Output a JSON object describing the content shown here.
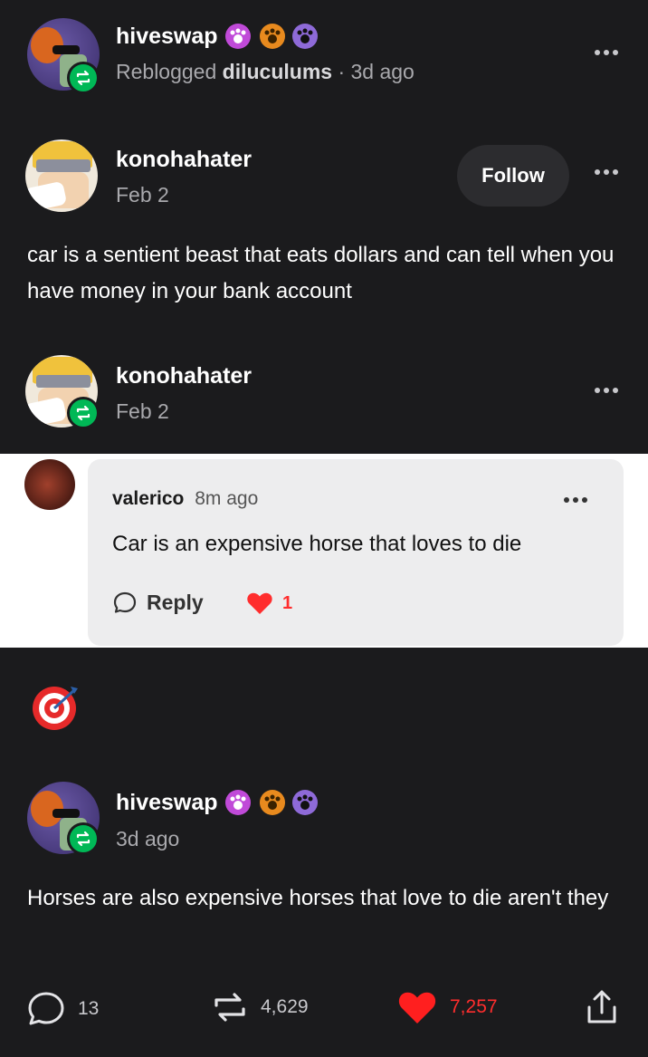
{
  "reblog_header": {
    "username": "hiveswap",
    "reblogged_label": "Reblogged",
    "reblogged_from": "diluculums",
    "time": "· 3d ago"
  },
  "original_post": {
    "username": "konohahater",
    "date": "Feb 2",
    "follow_label": "Follow",
    "text": "car is a sentient beast that eats dollars and can tell when you have money in your bank account"
  },
  "reblog_entry": {
    "username": "konohahater",
    "date": "Feb 2"
  },
  "reply": {
    "username": "valerico",
    "time": "8m ago",
    "text": "Car is an expensive horse that loves to die",
    "reply_label": "Reply",
    "like_count": "1"
  },
  "emoji": "🎯",
  "final_post": {
    "username": "hiveswap",
    "time": "3d ago",
    "text": "Horses are also expensive horses that love to die aren't they"
  },
  "footer": {
    "comments": "13",
    "reblogs": "4,629",
    "likes": "7,257"
  },
  "colors": {
    "background": "#1b1b1d",
    "reblog_green": "#00b856",
    "like_red": "#ff2d2d",
    "reply_card": "#ededee"
  },
  "icons": [
    "reblog-icon",
    "more-dots-icon",
    "paw-badge-icon",
    "comment-icon",
    "heart-icon",
    "share-icon",
    "reply-bubble-icon"
  ]
}
